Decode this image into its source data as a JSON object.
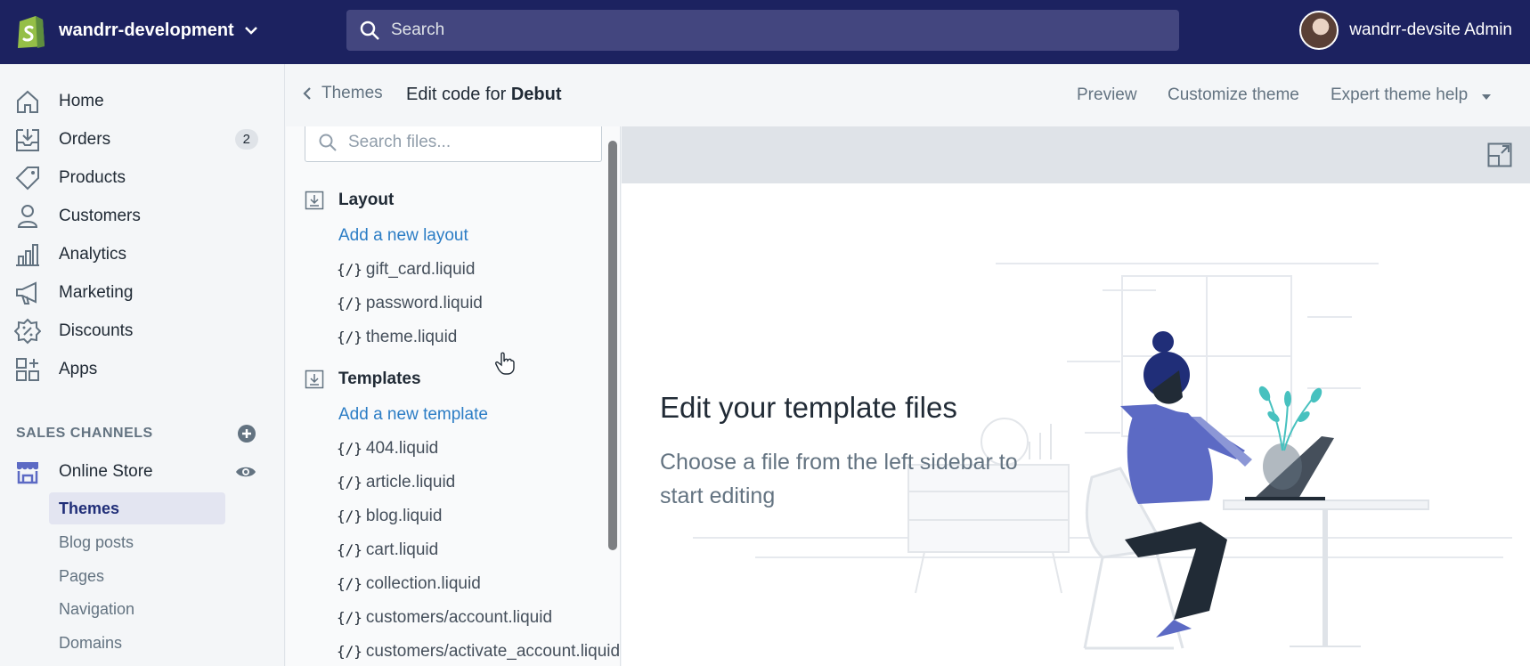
{
  "topbar": {
    "store_name": "wandrr-development",
    "search_placeholder": "Search",
    "user_name": "wandrr-devsite Admin"
  },
  "sidebar": {
    "items": [
      {
        "label": "Home",
        "icon": "home-icon"
      },
      {
        "label": "Orders",
        "icon": "orders-icon",
        "badge": "2"
      },
      {
        "label": "Products",
        "icon": "tag-icon"
      },
      {
        "label": "Customers",
        "icon": "person-icon"
      },
      {
        "label": "Analytics",
        "icon": "bar-chart-icon"
      },
      {
        "label": "Marketing",
        "icon": "megaphone-icon"
      },
      {
        "label": "Discounts",
        "icon": "discount-icon"
      },
      {
        "label": "Apps",
        "icon": "apps-icon"
      }
    ],
    "sales_channels_title": "SALES CHANNELS",
    "online_store": "Online Store",
    "sub_items": [
      "Themes",
      "Blog posts",
      "Pages",
      "Navigation",
      "Domains"
    ],
    "active_sub_item": "Themes"
  },
  "header": {
    "back_label": "Themes",
    "edit_prefix": "Edit code for",
    "theme_name": "Debut",
    "preview": "Preview",
    "customize": "Customize theme",
    "expert_help": "Expert theme help"
  },
  "files": {
    "search_placeholder": "Search files...",
    "layout_title": "Layout",
    "add_layout": "Add a new layout",
    "layout_files": [
      "gift_card.liquid",
      "password.liquid",
      "theme.liquid"
    ],
    "templates_title": "Templates",
    "add_template": "Add a new template",
    "template_files": [
      "404.liquid",
      "article.liquid",
      "blog.liquid",
      "cart.liquid",
      "collection.liquid",
      "customers/account.liquid",
      "customers/activate_account.liquid"
    ],
    "brace_glyph": "{/}"
  },
  "main": {
    "title": "Edit your template files",
    "subtitle": "Choose a file from the left sidebar to start editing"
  },
  "colors": {
    "topbar": "#1c2260",
    "search_bg": "#43467f",
    "link": "#2c7dc5",
    "active_nav": "#e3e5f1",
    "illustration_accent": "#5c6ac4",
    "illustration_dark": "#202e78"
  }
}
